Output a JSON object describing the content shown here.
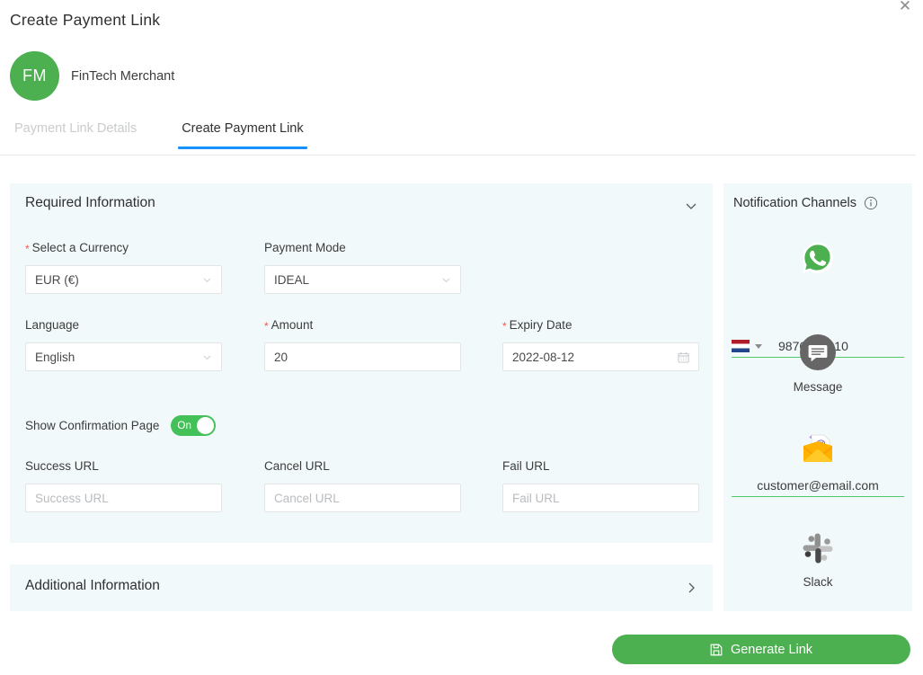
{
  "modal": {
    "title": "Create Payment Link",
    "close_label": "✕"
  },
  "merchant": {
    "initials": "FM",
    "name": "FinTech Merchant"
  },
  "tabs": [
    {
      "label": "Payment Link Details",
      "active": false
    },
    {
      "label": "Create Payment Link",
      "active": true
    }
  ],
  "required_section": {
    "heading": "Required Information",
    "collapse_state": "expanded",
    "fields": {
      "currency": {
        "label": "Select a Currency",
        "required": true,
        "value": "EUR (€)"
      },
      "payment_mode": {
        "label": "Payment Mode",
        "required": false,
        "value": "IDEAL"
      },
      "language": {
        "label": "Language",
        "required": false,
        "value": "English"
      },
      "amount": {
        "label": "Amount",
        "required": true,
        "value": "20"
      },
      "expiry_date": {
        "label": "Expiry Date",
        "required": true,
        "value": "2022-08-12"
      },
      "success_url": {
        "label": "Success URL",
        "required": false,
        "value": "",
        "placeholder": "Success URL"
      },
      "cancel_url": {
        "label": "Cancel URL",
        "required": false,
        "value": "",
        "placeholder": "Cancel URL"
      },
      "fail_url": {
        "label": "Fail URL",
        "required": false,
        "value": "",
        "placeholder": "Fail URL"
      }
    },
    "confirmation_toggle": {
      "label": "Show Confirmation Page",
      "state_label": "On",
      "enabled": true
    }
  },
  "additional_section": {
    "heading": "Additional Information",
    "collapse_state": "collapsed"
  },
  "notifications": {
    "title": "Notification Channels",
    "channels": [
      {
        "id": "whatsapp",
        "icon": "whatsapp-icon",
        "label": "",
        "value": "9876543210",
        "country_flag": "netherlands-flag",
        "active": true
      },
      {
        "id": "message",
        "icon": "message-icon",
        "label": "Message",
        "value": "",
        "active": false
      },
      {
        "id": "email",
        "icon": "email-icon",
        "label": "",
        "value": "customer@email.com",
        "active": true
      },
      {
        "id": "slack",
        "icon": "slack-icon",
        "label": "Slack",
        "value": "",
        "active": false
      }
    ]
  },
  "footer": {
    "generate_label": "Generate Link",
    "generate_icon": "save-icon"
  },
  "colors": {
    "accent_green": "#4caf50",
    "tab_active_blue": "#1890ff",
    "panel_bg": "#f2f9fb",
    "required_star": "#f5554a",
    "underline_green": "#4fc96a"
  }
}
